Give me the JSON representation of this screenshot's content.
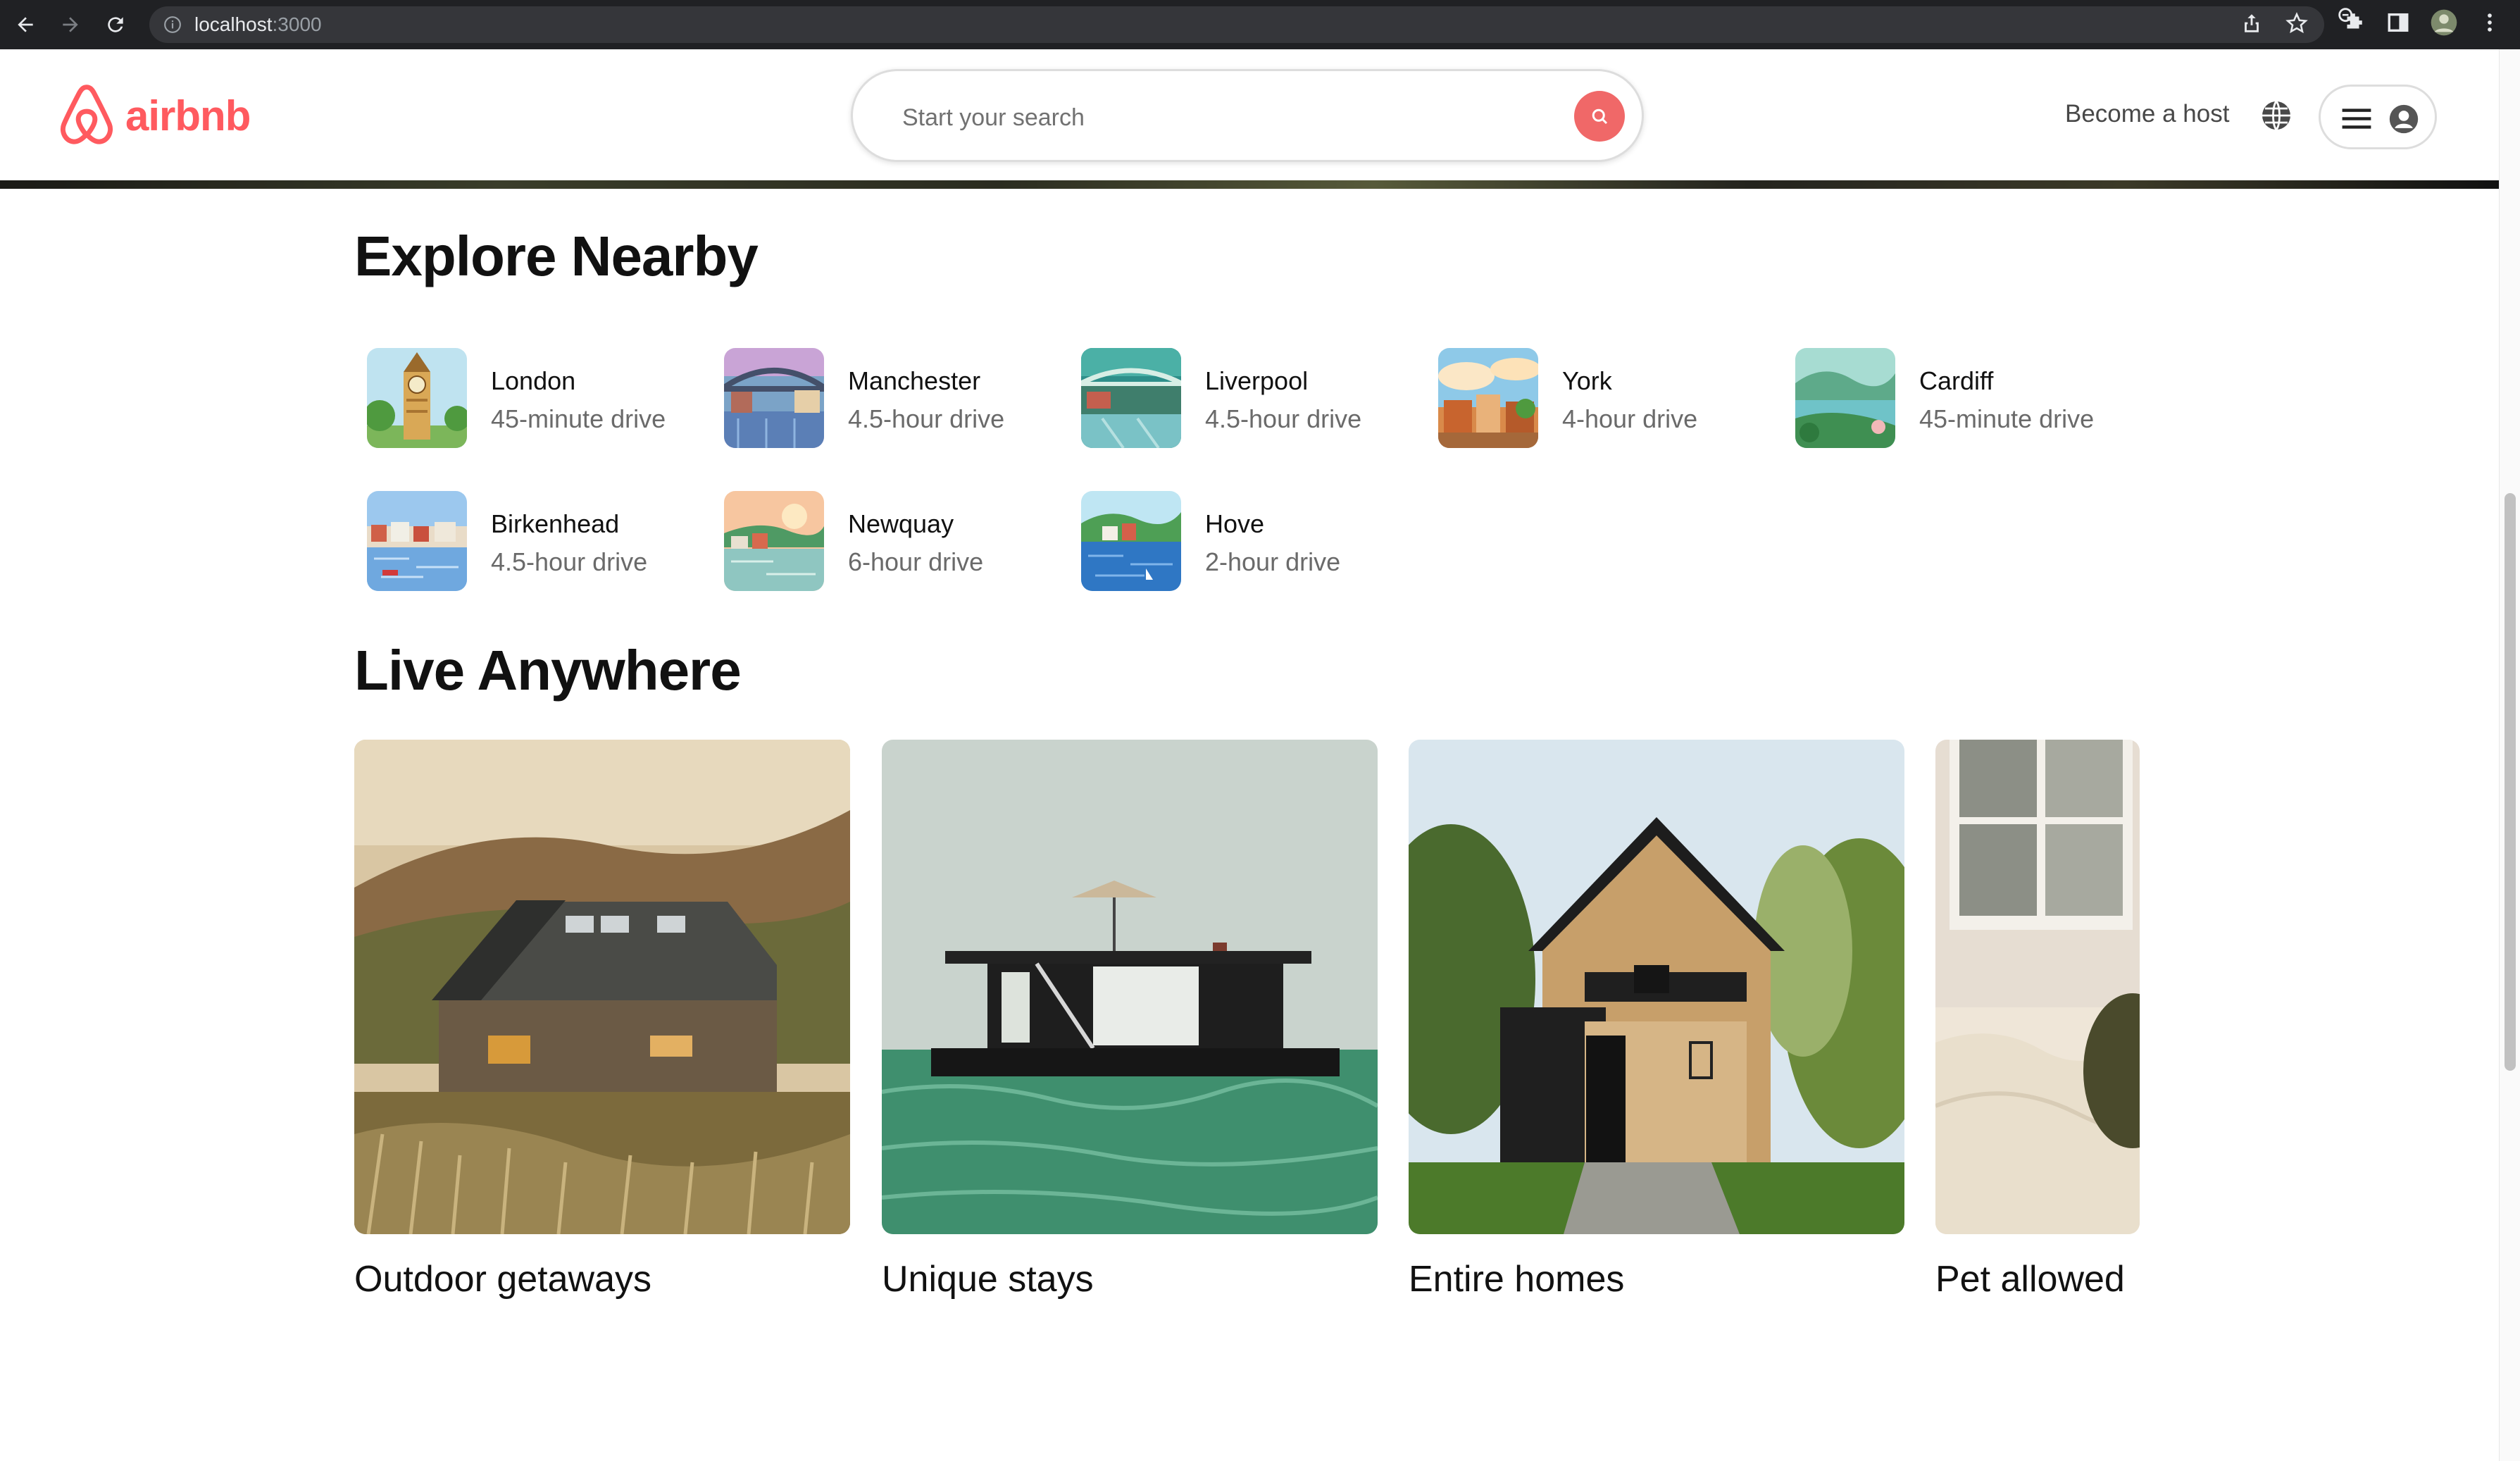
{
  "browser": {
    "url_host": "localhost",
    "url_port": ":3000",
    "icons": [
      "back-arrow-icon",
      "forward-arrow-icon",
      "reload-icon",
      "info-icon",
      "zoom-icon",
      "share-icon",
      "star-icon",
      "extensions-icon",
      "sidebar-icon",
      "profile-avatar-icon",
      "more-menu-icon"
    ]
  },
  "header": {
    "logo_text": "airbnb",
    "search_placeholder": "Start your search",
    "host_label": "Become a host",
    "icons": [
      "airbnb-logo-icon",
      "search-icon",
      "globe-icon",
      "menu-icon",
      "user-icon"
    ]
  },
  "colors": {
    "brand": "#ff5a5f",
    "search_button": "#f06868",
    "text": "#222222",
    "muted": "#6a6a6a"
  },
  "explore": {
    "title": "Explore Nearby",
    "items": [
      {
        "name": "London",
        "distance": "45-minute drive"
      },
      {
        "name": "Manchester",
        "distance": "4.5-hour drive"
      },
      {
        "name": "Liverpool",
        "distance": "4.5-hour drive"
      },
      {
        "name": "York",
        "distance": "4-hour drive"
      },
      {
        "name": "Cardiff",
        "distance": "45-minute drive"
      },
      {
        "name": "Birkenhead",
        "distance": "4.5-hour drive"
      },
      {
        "name": "Newquay",
        "distance": "6-hour drive"
      },
      {
        "name": "Hove",
        "distance": "2-hour drive"
      }
    ]
  },
  "live": {
    "title": "Live Anywhere",
    "cards": [
      {
        "title": "Outdoor getaways"
      },
      {
        "title": "Unique stays"
      },
      {
        "title": "Entire homes"
      },
      {
        "title": "Pet allowed"
      }
    ]
  }
}
